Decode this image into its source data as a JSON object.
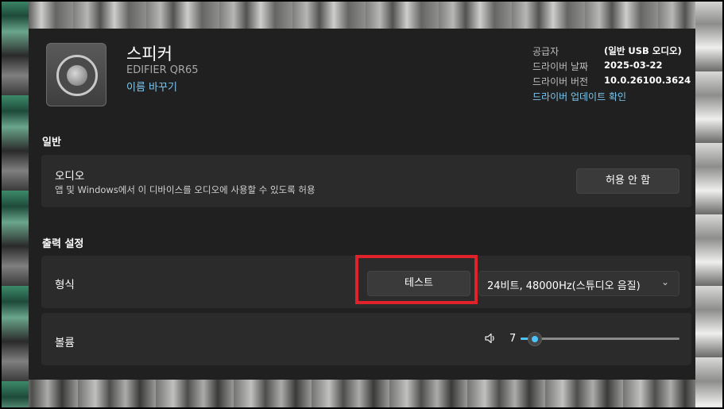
{
  "device": {
    "title": "스피커",
    "model": "EDIFIER QR65",
    "rename_link": "이름 바꾸기"
  },
  "info": {
    "provider_label": "공급자",
    "provider_value": "(일반 USB 오디오)",
    "driver_date_label": "드라이버 날짜",
    "driver_date_value": "2025-03-22",
    "driver_version_label": "드라이버 버전",
    "driver_version_value": "10.0.26100.3624",
    "update_link": "드라이버 업데이트 확인"
  },
  "general": {
    "section_title": "일반",
    "audio_label": "오디오",
    "audio_desc": "앱 및 Windows에서 이 디바이스를 오디오에 사용할 수 있도록 허용",
    "disallow_button": "허용 안 함"
  },
  "output": {
    "section_title": "출력 설정",
    "format_label": "형식",
    "test_button": "테스트",
    "format_value": "24비트, 48000Hz(스튜디오 음질)",
    "volume_label": "볼륨",
    "volume_value": "7",
    "volume_level": 0.07
  },
  "colors": {
    "accent": "#4cc2ff",
    "highlight": "#e0222a",
    "link": "#7cc7f0"
  },
  "icons": {
    "device": "speaker-device-icon",
    "volume": "speaker-volume-icon",
    "dropdown": "chevron-down-icon"
  }
}
